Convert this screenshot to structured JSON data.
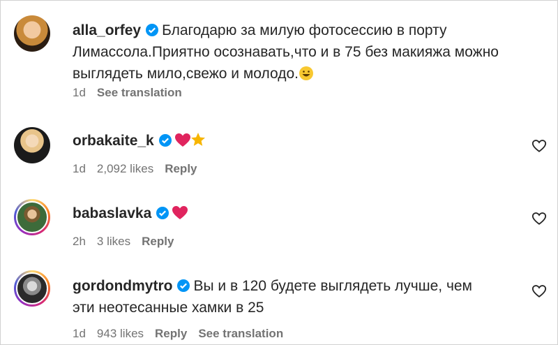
{
  "comments": [
    {
      "username": "alla_orfey",
      "verified": true,
      "text_line1": "Благодарю за милую фотосессию в порту",
      "text_line2": "Лимассола.Приятно осознавать,что и в 75 без макияжа можно",
      "text_line3": "выглядеть мило,свежо и молодо.",
      "emoji": "grinning-face",
      "time": "1d",
      "translation": "See translation"
    },
    {
      "username": "orbakaite_k",
      "verified": true,
      "emojis": [
        "red-heart",
        "star"
      ],
      "time": "1d",
      "likes": "2,092 likes",
      "reply": "Reply"
    },
    {
      "username": "babaslavka",
      "verified": true,
      "emojis": [
        "red-heart"
      ],
      "time": "2h",
      "likes": "3 likes",
      "reply": "Reply"
    },
    {
      "username": "gordondmytro",
      "verified": true,
      "text_line1": "Вы и в 120 будете выглядеть лучше, чем",
      "text_line2": "эти неотесанные хамки в 25",
      "time": "1d",
      "likes": "943 likes",
      "reply": "Reply",
      "translation": "See translation"
    }
  ],
  "colors": {
    "verified_blue": "#0095f6",
    "heart_red": "#e0245e",
    "star_gold": "#f7b500",
    "meta_gray": "#737373"
  }
}
